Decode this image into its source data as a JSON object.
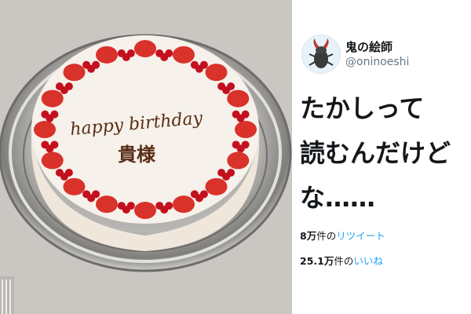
{
  "photo": {
    "cake_text_line1": "happy birthday",
    "cake_text_line2": "貴様",
    "colors": {
      "plate": "#a9a8a6",
      "icing": "#f6f1ea",
      "strawberry": "#d8322a",
      "currant": "#c4101e",
      "chocolate": "#5a2d16"
    }
  },
  "tweet": {
    "display_name": "鬼の絵師",
    "handle": "@oninoeshi",
    "avatar_icon": "stag-beetle-icon",
    "text_lines": [
      "たかしって",
      "読むんだけど",
      "な……"
    ],
    "retweets": {
      "count": "8万",
      "suffix": "件の",
      "label": "リツイート"
    },
    "likes": {
      "count": "25.1万",
      "suffix": "件の",
      "label": "いいね"
    },
    "colors": {
      "link": "#1da1f2",
      "text": "#14171a",
      "muted": "#657786"
    }
  }
}
